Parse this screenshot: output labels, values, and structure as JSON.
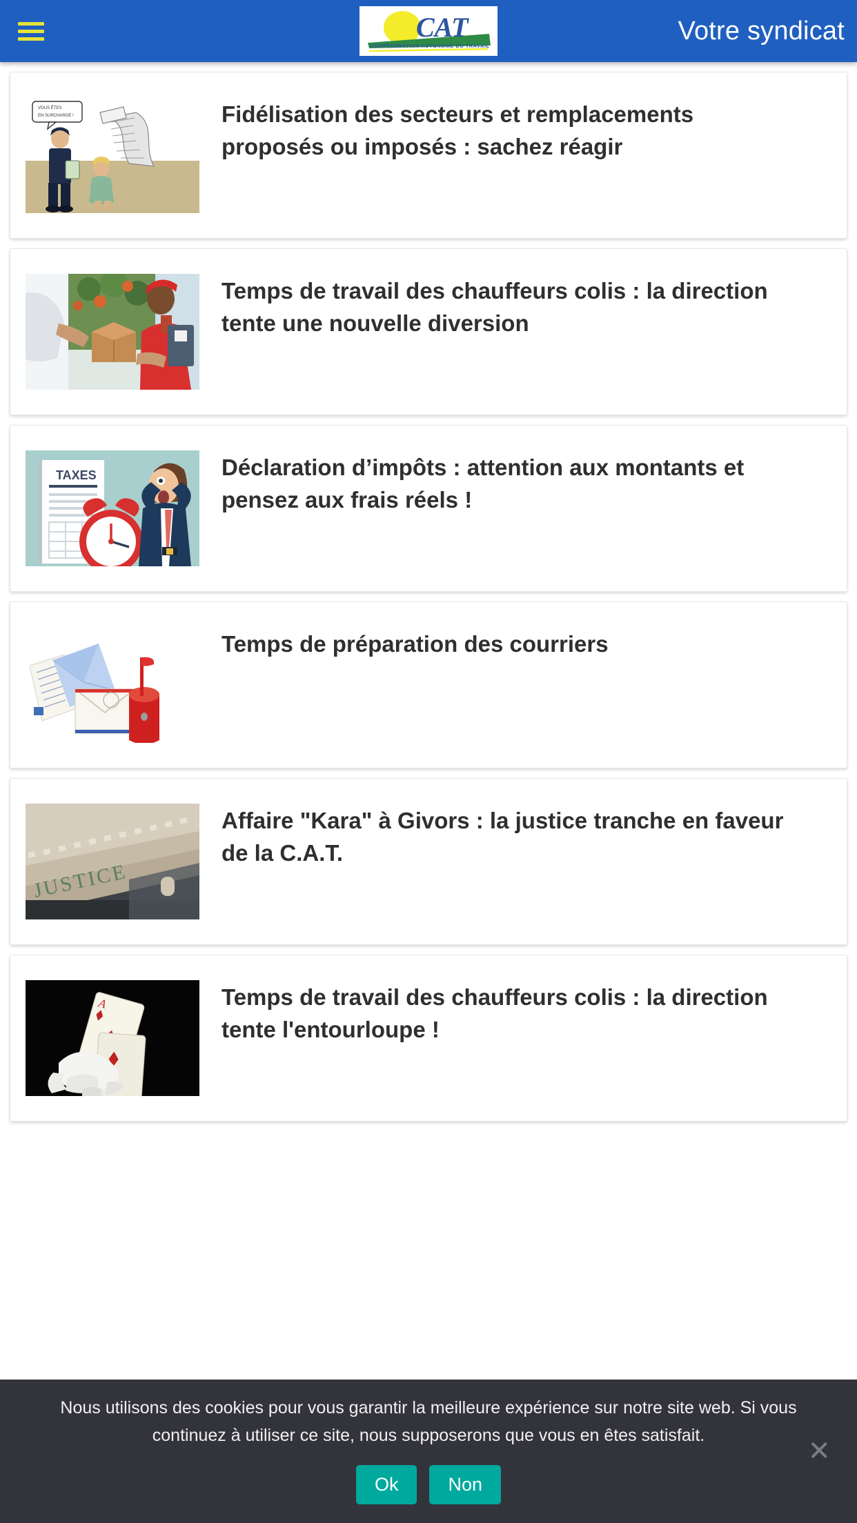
{
  "header": {
    "menu_icon": "hamburger-icon",
    "title": "Votre syndicat",
    "logo": {
      "acronym": "CAT",
      "tagline": "CONFEDERATION AUTONOME DU TRAVAIL"
    },
    "bg_color": "#1f5fc0",
    "menu_color": "#e7e337"
  },
  "posts": [
    {
      "title": "Fidélisation des secteurs et remplacements proposés ou imposés : sachez réagir",
      "thumb_name": "thumb-cartoon-surcharge",
      "thumb_alt": "Caricature : agent en surcharge avec pile de courrier"
    },
    {
      "title": "Temps de travail des chauffeurs colis : la direction tente une nouvelle diversion",
      "thumb_name": "thumb-delivery-parcel",
      "thumb_alt": "Livreur remettant un colis"
    },
    {
      "title": "Déclaration d’impôts : attention aux montants et pensez aux frais réels !",
      "thumb_name": "thumb-taxes-clock",
      "thumb_alt": "Illustration taxes avec réveil et personnage stressé"
    },
    {
      "title": "Temps de préparation des courriers",
      "thumb_name": "thumb-mailbox-letters",
      "thumb_alt": "Boîte aux lettres rouge et enveloppes"
    },
    {
      "title": "Affaire \"Kara\" à Givors : la justice tranche en faveur de la C.A.T.",
      "thumb_name": "thumb-justice-building",
      "thumb_alt": "Fronton d'un palais de justice avec le mot JUSTICE"
    },
    {
      "title": "Temps de travail des chauffeurs colis : la direction tente l'entourloupe !",
      "thumb_name": "thumb-magician-cards",
      "thumb_alt": "Main gantée de magicien tenant un as de carreau"
    }
  ],
  "cookie_notice": {
    "message": "Nous utilisons des cookies pour vous garantir la meilleure expérience sur notre site web. Si vous continuez à utiliser ce site, nous supposerons que vous en êtes satisfait.",
    "accept_label": "Ok",
    "decline_label": "Non",
    "close_label": "✕",
    "bg_color": "#33333b",
    "button_color": "#00a99d"
  }
}
